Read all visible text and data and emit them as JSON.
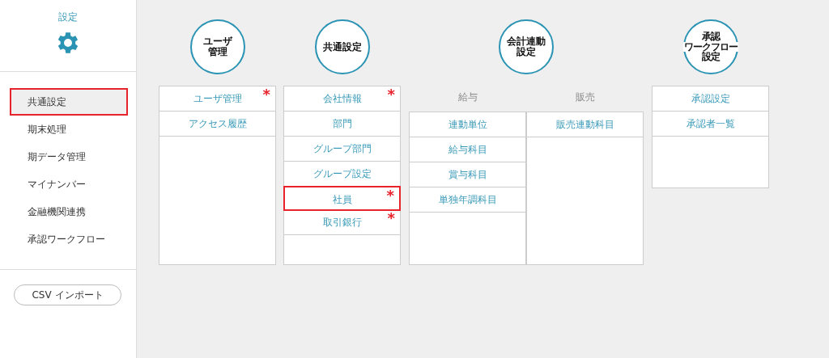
{
  "sidebar": {
    "title": "設定",
    "nav": [
      {
        "label": "共通設定",
        "selected": true
      },
      {
        "label": "期末処理",
        "selected": false
      },
      {
        "label": "期データ管理",
        "selected": false
      },
      {
        "label": "マイナンバー",
        "selected": false
      },
      {
        "label": "金融機関連携",
        "selected": false
      },
      {
        "label": "承認ワークフロー",
        "selected": false
      }
    ],
    "import_button": "CSV インポート"
  },
  "groups": [
    {
      "kind": "list",
      "title": [
        "ユーザ",
        "管理"
      ],
      "items": [
        {
          "label": "ユーザ管理",
          "mark": "*",
          "highlighted": false
        },
        {
          "label": "アクセス履歴",
          "highlighted": false
        }
      ]
    },
    {
      "kind": "list",
      "title": [
        "共通設定"
      ],
      "items": [
        {
          "label": "会社情報",
          "mark": "*",
          "highlighted": false
        },
        {
          "label": "部門",
          "highlighted": false
        },
        {
          "label": "グループ部門",
          "highlighted": false
        },
        {
          "label": "グループ設定",
          "highlighted": false
        },
        {
          "label": "社員",
          "mark": "*",
          "highlighted": true
        },
        {
          "label": "取引銀行",
          "mark": "*",
          "highlighted": false
        }
      ]
    },
    {
      "kind": "split",
      "title": [
        "会計連動",
        "設定"
      ],
      "sections": [
        {
          "heading": "給与",
          "items": [
            {
              "label": "連動単位",
              "highlighted": false
            },
            {
              "label": "給与科目",
              "highlighted": false
            },
            {
              "label": "賞与科目",
              "highlighted": false
            },
            {
              "label": "単独年調科目",
              "highlighted": false
            }
          ]
        },
        {
          "heading": "販売",
          "items": [
            {
              "label": "販売連動科目",
              "highlighted": false
            }
          ]
        }
      ]
    },
    {
      "kind": "list",
      "title": [
        "承認",
        "ワークフロー",
        "設定"
      ],
      "items": [
        {
          "label": "承認設定",
          "highlighted": false
        },
        {
          "label": "承認者一覧",
          "highlighted": false
        }
      ]
    }
  ]
}
